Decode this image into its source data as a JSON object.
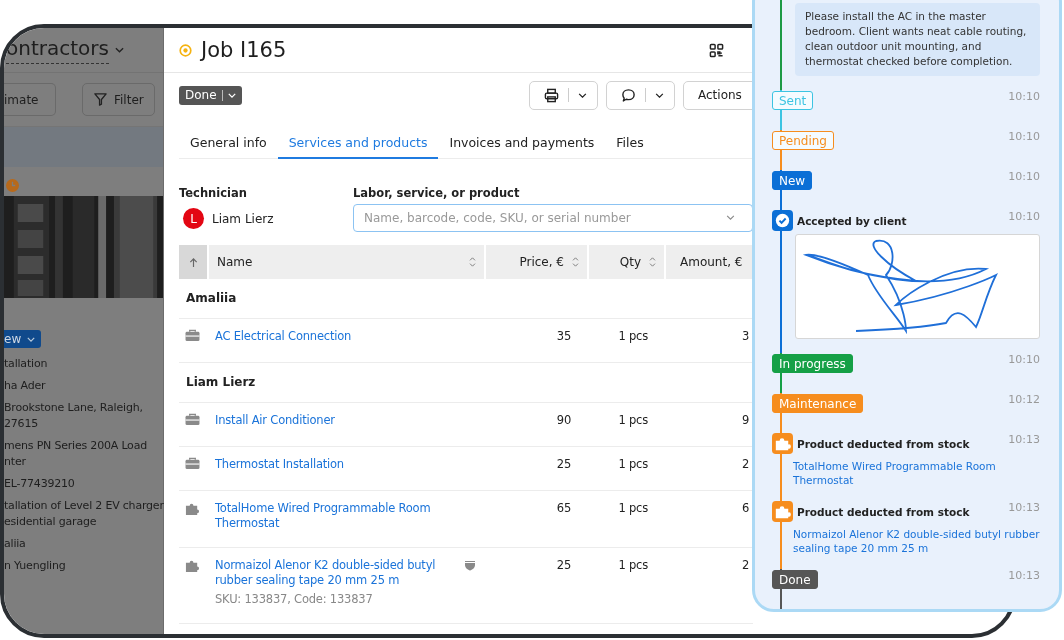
{
  "background_app": {
    "title": "ontractors",
    "buttons": [
      "imate",
      "Filter"
    ],
    "status_button": "ew",
    "details": [
      [
        "tallation"
      ],
      [
        "ha Ader"
      ],
      [
        "Brookstone Lane, Raleigh,",
        "27615"
      ],
      [
        "mens PN Series 200A Load",
        "nter"
      ],
      [
        "EL-77439210"
      ],
      [
        "tallation of Level 2 EV charger",
        "esidential garage"
      ],
      [
        "aliia"
      ],
      [
        "n Yuengling"
      ]
    ]
  },
  "job": {
    "title": "Job I165",
    "status": "Done",
    "actions": "Actions",
    "tabs": [
      {
        "label": "General info",
        "selected": false
      },
      {
        "label": "Services and products",
        "selected": true
      },
      {
        "label": "Invoices and payments",
        "selected": false
      },
      {
        "label": "Files",
        "selected": false
      }
    ],
    "technician": {
      "label": "Technician",
      "initial": "L",
      "name": "Liam Lierz"
    },
    "product_field": {
      "label": "Labor, service, or product",
      "placeholder": "Name, barcode, code, SKU, or serial number"
    },
    "table": {
      "columns": [
        "Name",
        "Price, €",
        "Qty",
        "Amount, €"
      ],
      "groups": [
        {
          "name": "Amaliia",
          "items": [
            {
              "kind": "service",
              "name": "AC Electrical Connection",
              "price": "35",
              "qty": "1 pcs",
              "amount": "3",
              "badge": false
            }
          ]
        },
        {
          "name": "Liam Lierz",
          "items": [
            {
              "kind": "service",
              "name": "Install Air Conditioner",
              "price": "90",
              "qty": "1 pcs",
              "amount": "9",
              "badge": false
            },
            {
              "kind": "service",
              "name": "Thermostat Installation",
              "price": "25",
              "qty": "1 pcs",
              "amount": "2",
              "badge": false
            },
            {
              "kind": "product",
              "name": "TotalHome Wired Programmable Room Thermostat",
              "price": "65",
              "qty": "1 pcs",
              "amount": "6",
              "badge": false
            },
            {
              "kind": "product",
              "name": "Normaizol Alenor K2 double-sided butyl rubber sealing tape 20 mm 25 m",
              "sku": "SKU: 133837, Code: 133837",
              "price": "25",
              "qty": "1 pcs",
              "amount": "2",
              "badge": true
            }
          ]
        }
      ]
    }
  },
  "timeline": [
    {
      "kind": "note",
      "color": "#1d9a45",
      "text": "Please install the AC in the master bedroom. Client wants neat cable routing, clean outdoor unit mounting, and thermostat checked before completion."
    },
    {
      "kind": "status",
      "label": "Sent",
      "outline": true,
      "time": "10:10",
      "color": "#3cc4e2"
    },
    {
      "kind": "status",
      "label": "Pending",
      "outline": true,
      "time": "10:10",
      "color": "#f68d1e"
    },
    {
      "kind": "status",
      "label": "New",
      "outline": false,
      "time": "10:10",
      "color": "#0b6fd6"
    },
    {
      "kind": "signature",
      "title": "Accepted by client",
      "time": "10:10",
      "color": "#0b6fd6"
    },
    {
      "kind": "status",
      "label": "In progress",
      "outline": false,
      "time": "10:10",
      "color": "#15a046"
    },
    {
      "kind": "status",
      "label": "Maintenance",
      "outline": false,
      "time": "10:12",
      "color": "#f68d1e"
    },
    {
      "kind": "stock",
      "title": "Product deducted from stock",
      "link": "TotalHome Wired Programmable Room Thermostat",
      "time": "10:13",
      "color": "#f68d1e"
    },
    {
      "kind": "stock",
      "title": "Product deducted from stock",
      "link": "Normaizol Alenor K2 double-sided butyl rubber sealing tape 20 mm 25 m",
      "time": "10:13",
      "color": "#f68d1e"
    },
    {
      "kind": "status",
      "label": "Done",
      "outline": false,
      "time": "10:13",
      "color": "#565656"
    }
  ]
}
